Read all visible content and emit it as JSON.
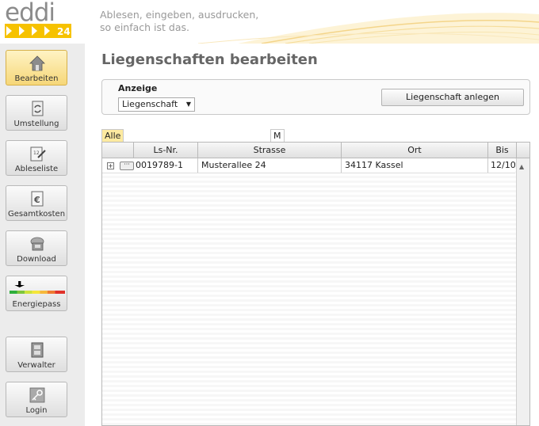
{
  "header": {
    "logo_text": "eddi",
    "logo_badge": "24",
    "tagline_line1": "Ablesen, eingeben, ausdrucken,",
    "tagline_line2": "so einfach ist das."
  },
  "sidebar": {
    "items": [
      {
        "label": "Bearbeiten",
        "icon": "house-icon",
        "active": true
      },
      {
        "label": "Umstellung",
        "icon": "refresh-document-icon",
        "active": false
      },
      {
        "label": "Ableseliste",
        "icon": "meter-list-icon",
        "active": false
      },
      {
        "label": "Gesamtkosten",
        "icon": "euro-document-icon",
        "active": false
      },
      {
        "label": "Download",
        "icon": "download-disk-icon",
        "active": false
      },
      {
        "label": "Energiepass",
        "icon": "energy-scale-icon",
        "active": false
      },
      {
        "label": "Verwalter",
        "icon": "manager-icon",
        "active": false
      },
      {
        "label": "Login",
        "icon": "key-icon",
        "active": false
      }
    ]
  },
  "main": {
    "title": "Liegenschaften bearbeiten",
    "anzeige_label": "Anzeige",
    "anzeige_select": "Liegenschaft",
    "create_button": "Liegenschaft anlegen",
    "tabs": [
      "Alle",
      "M"
    ]
  },
  "table": {
    "columns": [
      "Ls-Nr.",
      "Strasse",
      "Ort",
      "Bis"
    ],
    "rows": [
      {
        "ls_nr": "0019789-1",
        "strasse": "Musterallee 24",
        "ort": "34117 Kassel",
        "bis": "12/10"
      }
    ]
  },
  "colors": {
    "accent_yellow": "#f6c200",
    "active_button": "#f6d779",
    "title_gray": "#666666"
  }
}
